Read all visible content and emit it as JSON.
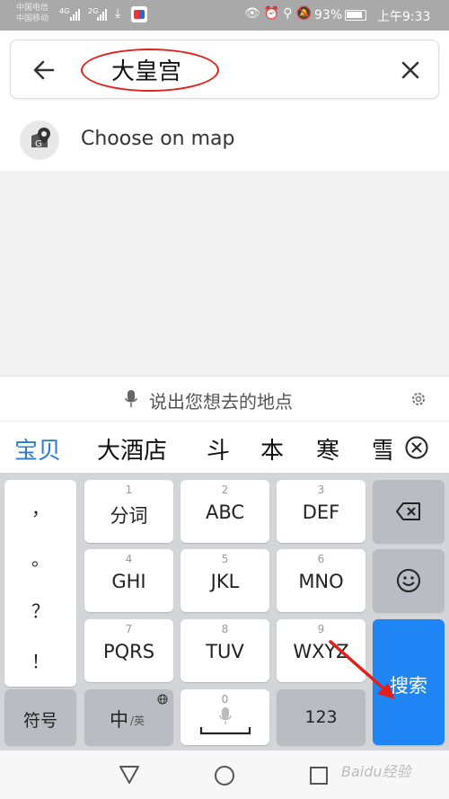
{
  "status": {
    "carrier1": "中国电信",
    "carrier2": "中国移动",
    "net1": "4G",
    "net2": "2G",
    "battery": "93%",
    "time": "上午9:33"
  },
  "search": {
    "query": "大皇宫"
  },
  "choose_on_map": "Choose on map",
  "voice_prompt": "说出您想去的地点",
  "candidates": [
    "宝贝",
    "大酒店",
    "斗",
    "本",
    "寒",
    "雪"
  ],
  "keyboard": {
    "punct": [
      "，",
      "。",
      "？",
      "！"
    ],
    "keys": [
      {
        "num": "1",
        "label": "分词"
      },
      {
        "num": "2",
        "label": "ABC"
      },
      {
        "num": "3",
        "label": "DEF"
      },
      {
        "num": "4",
        "label": "GHI"
      },
      {
        "num": "5",
        "label": "JKL"
      },
      {
        "num": "6",
        "label": "MNO"
      },
      {
        "num": "7",
        "label": "PQRS"
      },
      {
        "num": "8",
        "label": "TUV"
      },
      {
        "num": "9",
        "label": "WXYZ"
      }
    ],
    "symbol_key": "符号",
    "lang_key_main": "中",
    "lang_key_sub": "/英",
    "space_num": "0",
    "num_key": "123",
    "search_key": "搜索"
  },
  "watermark": "Baidu经验",
  "colors": {
    "accent": "#1f85f5",
    "annotation": "#e0201b",
    "candidate_active": "#2a7ad5"
  }
}
